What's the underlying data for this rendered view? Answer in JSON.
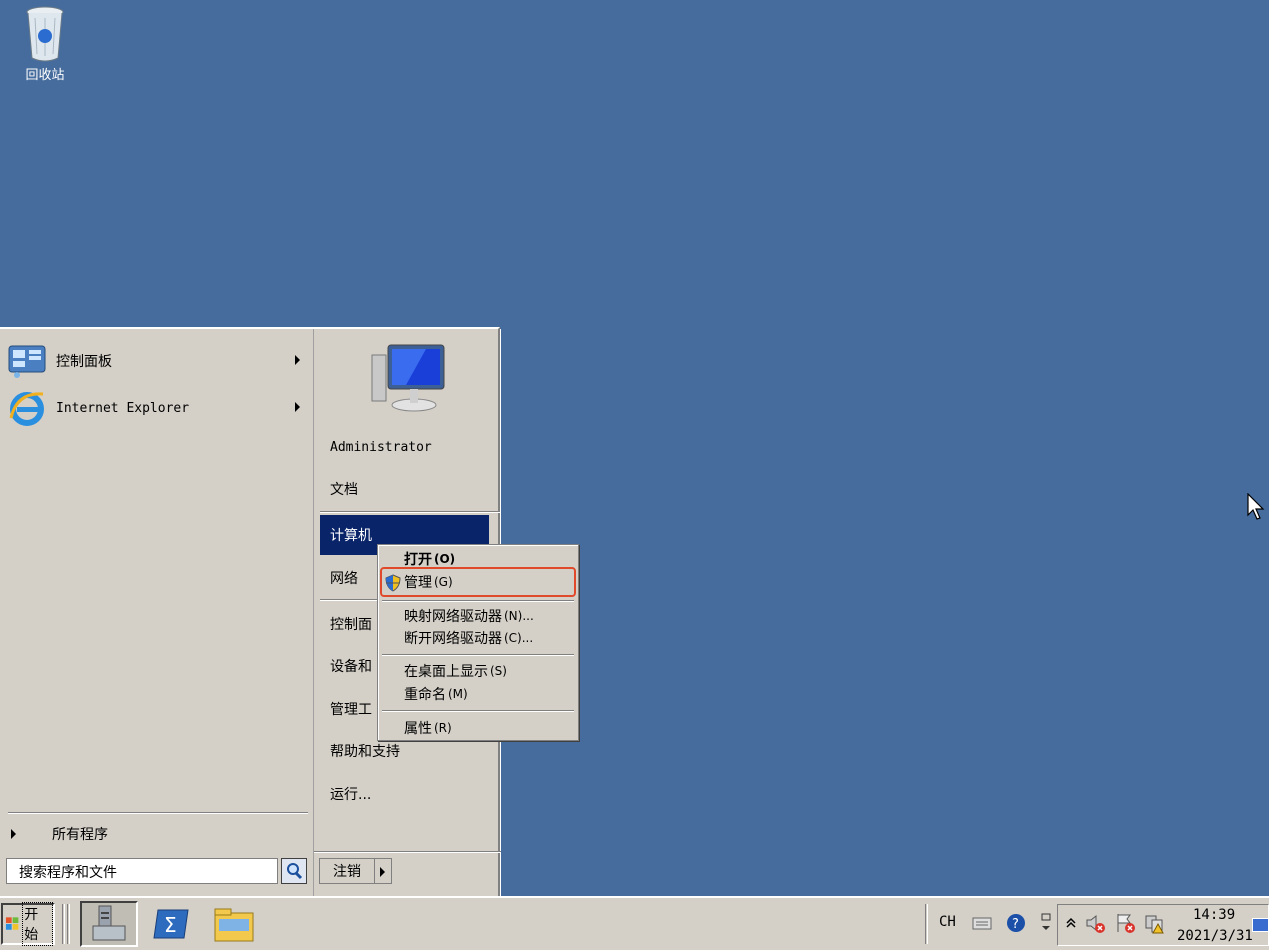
{
  "desktop": {
    "recycle_bin_label": "回收站"
  },
  "start_menu": {
    "programs": [
      {
        "label": "控制面板",
        "icon": "control-panel-icon",
        "has_submenu": true
      },
      {
        "label": "Internet Explorer",
        "icon": "internet-explorer-icon",
        "has_submenu": true
      }
    ],
    "all_programs_label": "所有程序",
    "search_placeholder": "搜索程序和文件",
    "right": {
      "user_label": "Administrator",
      "documents": "文档",
      "computer": "计算机",
      "network": "网络",
      "control_panel": "控制面",
      "devices": "设备和",
      "admin_tools": "管理工",
      "help": "帮助和支持",
      "run": "运行..."
    },
    "logoff_label": "注销"
  },
  "context_menu": {
    "open": {
      "label": "打开",
      "accel": "(O)"
    },
    "manage": {
      "label": "管理",
      "accel": "(G)"
    },
    "map_drive": {
      "label": "映射网络驱动器",
      "accel": "(N)..."
    },
    "disconnect_drive": {
      "label": "断开网络驱动器",
      "accel": "(C)..."
    },
    "show_on_desktop": {
      "label": "在桌面上显示",
      "accel": "(S)"
    },
    "rename": {
      "label": "重命名",
      "accel": "(M)"
    },
    "properties": {
      "label": "属性",
      "accel": "(R)"
    },
    "highlight_color": "#e04a2a"
  },
  "taskbar": {
    "start_label": "开始",
    "apps": [
      "server-manager-icon",
      "powershell-icon",
      "file-explorer-icon"
    ],
    "tray": {
      "language": "CH",
      "time": "14:39",
      "date": "2021/3/31"
    }
  },
  "colors": {
    "desktop": "#466c9e",
    "selection": "#0a246a",
    "menu": "#d4d0c8"
  }
}
